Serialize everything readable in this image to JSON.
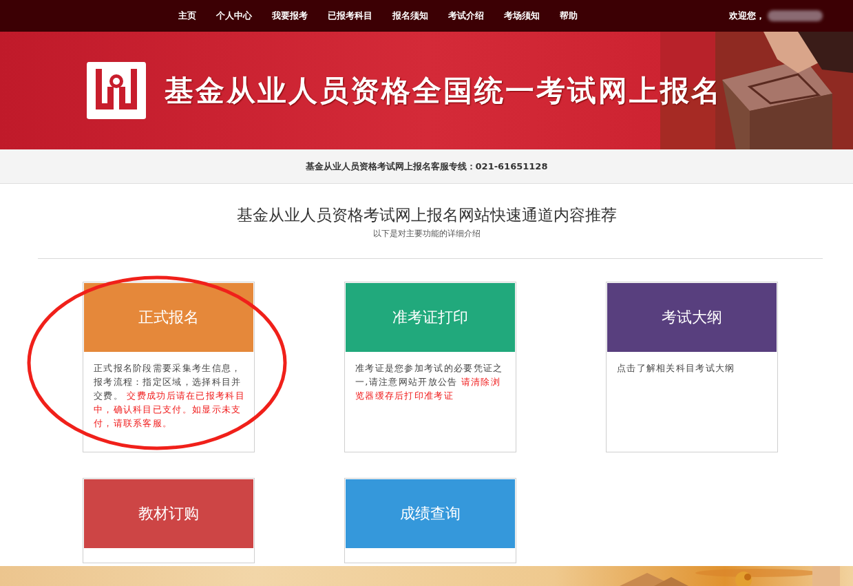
{
  "nav": {
    "items": [
      {
        "label": "主页"
      },
      {
        "label": "个人中心"
      },
      {
        "label": "我要报考"
      },
      {
        "label": "已报考科目"
      },
      {
        "label": "报名须知"
      },
      {
        "label": "考试介绍"
      },
      {
        "label": "考场须知"
      },
      {
        "label": "帮助"
      }
    ],
    "greeting": "欢迎您，"
  },
  "banner": {
    "title": "基金从业人员资格全国统一考试网上报名"
  },
  "hotline": "基金从业人员资格考试网上报名客服专线：021-61651128",
  "intro": {
    "heading": "基金从业人员资格考试网上报名网站快速通道内容推荐",
    "subtitle": "以下是对主要功能的详细介绍"
  },
  "cards": [
    {
      "title": "正式报名",
      "color": "#e5883a",
      "body": [
        {
          "text": "正式报名阶段需要采集考生信息，报考流程：指定区域，选择科目并交费。",
          "alert": false
        },
        {
          "text": " 交费成功后请在已报考科目中，确认科目已支付。如显示未支付，请联系客服。",
          "alert": true
        }
      ],
      "circled": true
    },
    {
      "title": "准考证打印",
      "color": "#21a97c",
      "body": [
        {
          "text": "准考证是您参加考试的必要凭证之一,请注意网站开放公告 ",
          "alert": false
        },
        {
          "text": "请清除浏览器缓存后打印准考证",
          "alert": true
        }
      ],
      "circled": false
    },
    {
      "title": "考试大纲",
      "color": "#583f7e",
      "body": [
        {
          "text": "点击了解相关科目考试大纲",
          "alert": false
        }
      ],
      "circled": false
    },
    {
      "title": "教材订购",
      "color": "#cd4545",
      "circled": false
    },
    {
      "title": "成绩查询",
      "color": "#3598db",
      "circled": false
    }
  ]
}
